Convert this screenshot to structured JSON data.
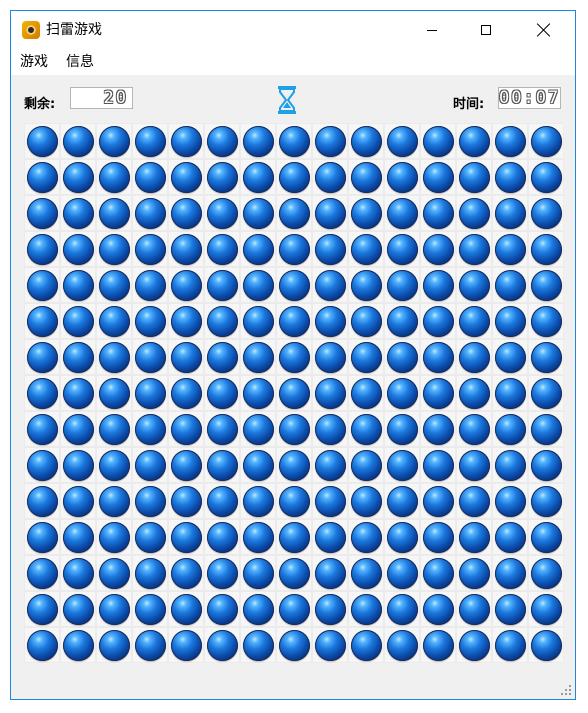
{
  "window": {
    "title": "扫雷游戏",
    "accent": "#1f86d9"
  },
  "menu": {
    "items": [
      "游戏",
      "信息"
    ]
  },
  "status": {
    "remaining_label": "剩余:",
    "remaining_value": "20",
    "time_label": "时间:",
    "time_value": "00:07",
    "hourglass_icon": "hourglass-icon"
  },
  "board": {
    "rows": 15,
    "cols": 15,
    "cell_state": "unrevealed",
    "cell_color": "#1c78dd"
  }
}
